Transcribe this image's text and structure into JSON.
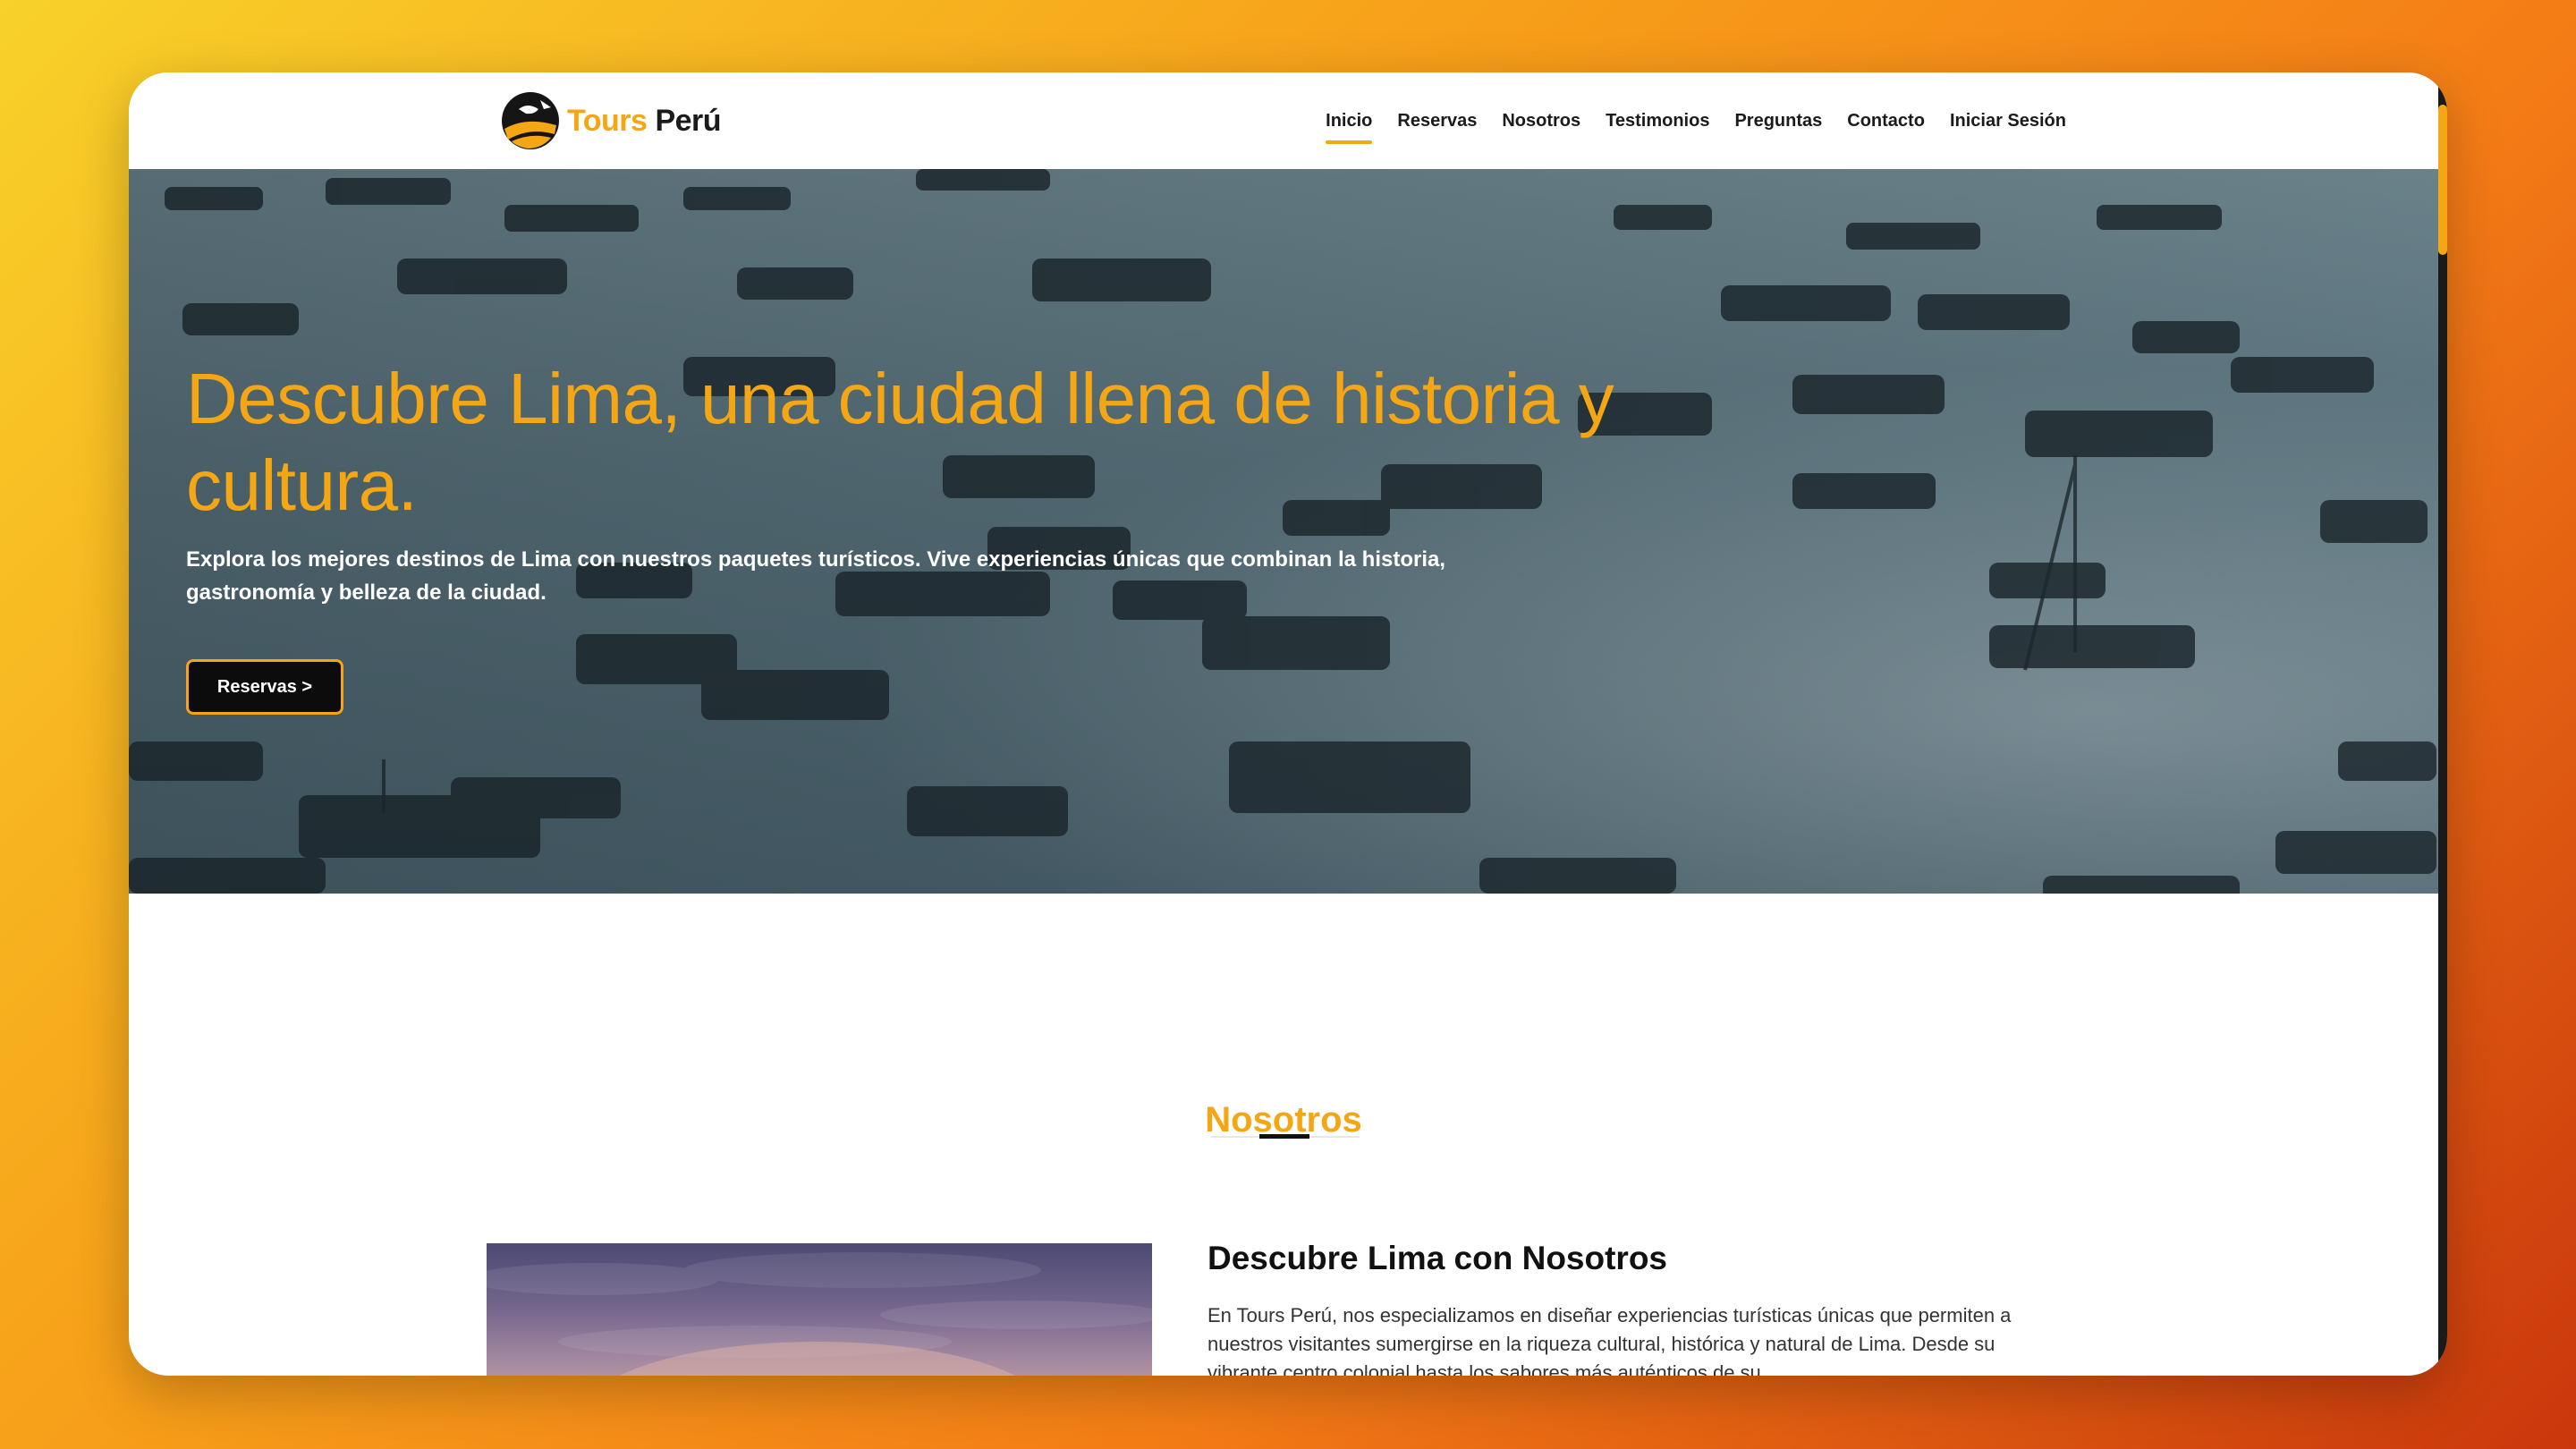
{
  "brand": {
    "name_part1": "Tours",
    "name_part2": "Perú"
  },
  "nav": {
    "items": [
      {
        "label": "Inicio",
        "active": true
      },
      {
        "label": "Reservas",
        "active": false
      },
      {
        "label": "Nosotros",
        "active": false
      },
      {
        "label": "Testimonios",
        "active": false
      },
      {
        "label": "Preguntas",
        "active": false
      },
      {
        "label": "Contacto",
        "active": false
      },
      {
        "label": "Iniciar Sesión",
        "active": false
      }
    ]
  },
  "hero": {
    "title": "Descubre Lima, una ciudad llena de historia y cultura.",
    "subtitle": "Explora los mejores destinos de Lima con nuestros paquetes turísticos. Vive experiencias únicas que combinan la historia, gastronomía y belleza de la ciudad.",
    "button_label": "Reservas >"
  },
  "about": {
    "section_title": "Nosotros",
    "heading": "Descubre Lima con Nosotros",
    "text": "En Tours Perú, nos especializamos en diseñar experiencias turísticas únicas que permiten a nuestros visitantes sumergirse en la riqueza cultural, histórica y natural de Lima. Desde su vibrante centro colonial hasta los sabores más auténticos de su"
  },
  "colors": {
    "accent": "#f5a614",
    "dark": "#111111",
    "button_bg": "#0c0c0c"
  }
}
